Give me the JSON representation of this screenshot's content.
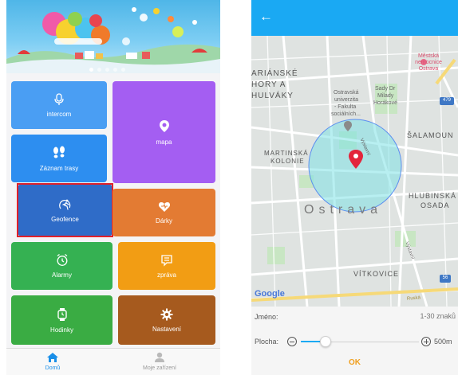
{
  "left": {
    "tiles": {
      "intercom": "intercom",
      "mapa": "mapa",
      "zaznam": "Záznam trasy",
      "geofence": "Geofence",
      "darky": "Dárky",
      "alarmy": "Alarmy",
      "zprava": "zpráva",
      "hodinky": "Hodinky",
      "nastaveni": "Nastavení"
    },
    "nav": {
      "home": "Domů",
      "device": "Moje zařízení"
    }
  },
  "right": {
    "map_labels": {
      "hospital": "Městská nemocnice Ostrava",
      "district_1a": "ARIÁNSKÉ",
      "district_1b": "HORY A",
      "district_1c": "HULVÁKY",
      "univ_1": "Ostravská",
      "univ_2": "univerzita",
      "univ_3": "- Fakulta",
      "univ_4": "sociálních...",
      "park_1": "Sady Dr",
      "park_2": "Milady",
      "park_3": "Horákové",
      "salamoun": "ŠALAMOUN",
      "martin_1": "MARTINSKÁ",
      "martin_2": "KOLONIE",
      "street1": "Výstavní",
      "street2": "Výstavní",
      "ostrava": "Ostrava",
      "hlub_1": "HLUBINSKÁ",
      "hlub_2": "OSADA",
      "vitkovice": "VÍTKOVICE",
      "road_badge": "479",
      "road_badge2": "56",
      "google": "Google",
      "bottom_street": "Ruská"
    },
    "form": {
      "name_label": "Jméno:",
      "name_placeholder": "1-30 znaků",
      "area_label": "Plocha:",
      "area_value": "500m",
      "ok": "OK"
    }
  },
  "colors": {
    "intercom": "#4a9ef3",
    "mapa": "#a45ef2",
    "zaznam": "#2d8ef0",
    "geofence": "#2f6cc8",
    "darky": "#e37b33",
    "alarmy": "#35b152",
    "zprava": "#f29d14",
    "hodinky": "#3aac43",
    "nastaveni": "#a65a1e",
    "topbar": "#1aa9f3",
    "selection": "#e0202a"
  }
}
